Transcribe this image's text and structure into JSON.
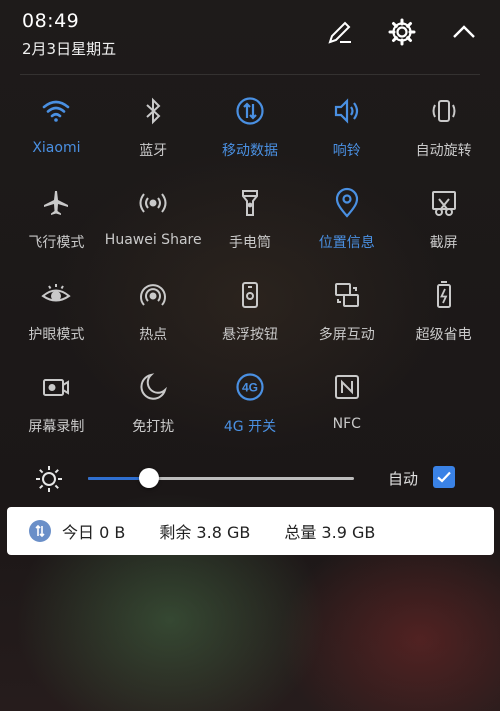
{
  "status": {
    "time": "08:49",
    "date": "2月3日星期五"
  },
  "header_actions": {
    "edit": "edit-icon",
    "settings": "gear-icon",
    "collapse": "chevron-up-icon"
  },
  "tiles": [
    {
      "label": "Xiaomi",
      "icon": "wifi-icon",
      "active": true
    },
    {
      "label": "蓝牙",
      "icon": "bluetooth-icon",
      "active": false
    },
    {
      "label": "移动数据",
      "icon": "mobile-data-icon",
      "active": true
    },
    {
      "label": "响铃",
      "icon": "ring-icon",
      "active": true
    },
    {
      "label": "自动旋转",
      "icon": "auto-rotate-icon",
      "active": false
    },
    {
      "label": "飞行模式",
      "icon": "airplane-icon",
      "active": false
    },
    {
      "label": "Huawei Share",
      "icon": "huawei-share-icon",
      "active": false
    },
    {
      "label": "手电筒",
      "icon": "flashlight-icon",
      "active": false
    },
    {
      "label": "位置信息",
      "icon": "location-icon",
      "active": true
    },
    {
      "label": "截屏",
      "icon": "screenshot-icon",
      "active": false
    },
    {
      "label": "护眼模式",
      "icon": "eye-comfort-icon",
      "active": false
    },
    {
      "label": "热点",
      "icon": "hotspot-icon",
      "active": false
    },
    {
      "label": "悬浮按钮",
      "icon": "floating-button-icon",
      "active": false
    },
    {
      "label": "多屏互动",
      "icon": "multi-screen-icon",
      "active": false
    },
    {
      "label": "超级省电",
      "icon": "battery-saver-icon",
      "active": false
    },
    {
      "label": "屏幕录制",
      "icon": "screen-record-icon",
      "active": false
    },
    {
      "label": "免打扰",
      "icon": "do-not-disturb-icon",
      "active": false
    },
    {
      "label": "4G 开关",
      "icon": "4g-icon",
      "active": true
    },
    {
      "label": "NFC",
      "icon": "nfc-icon",
      "active": false
    }
  ],
  "brightness": {
    "level": 0.23,
    "auto_label": "自动",
    "auto_checked": true
  },
  "data_usage": {
    "today": "今日 0 B",
    "remaining": "剩余 3.8 GB",
    "total": "总量 3.9 GB"
  },
  "colors": {
    "accent": "#4a90e2",
    "inactive": "#c9c9c9"
  }
}
